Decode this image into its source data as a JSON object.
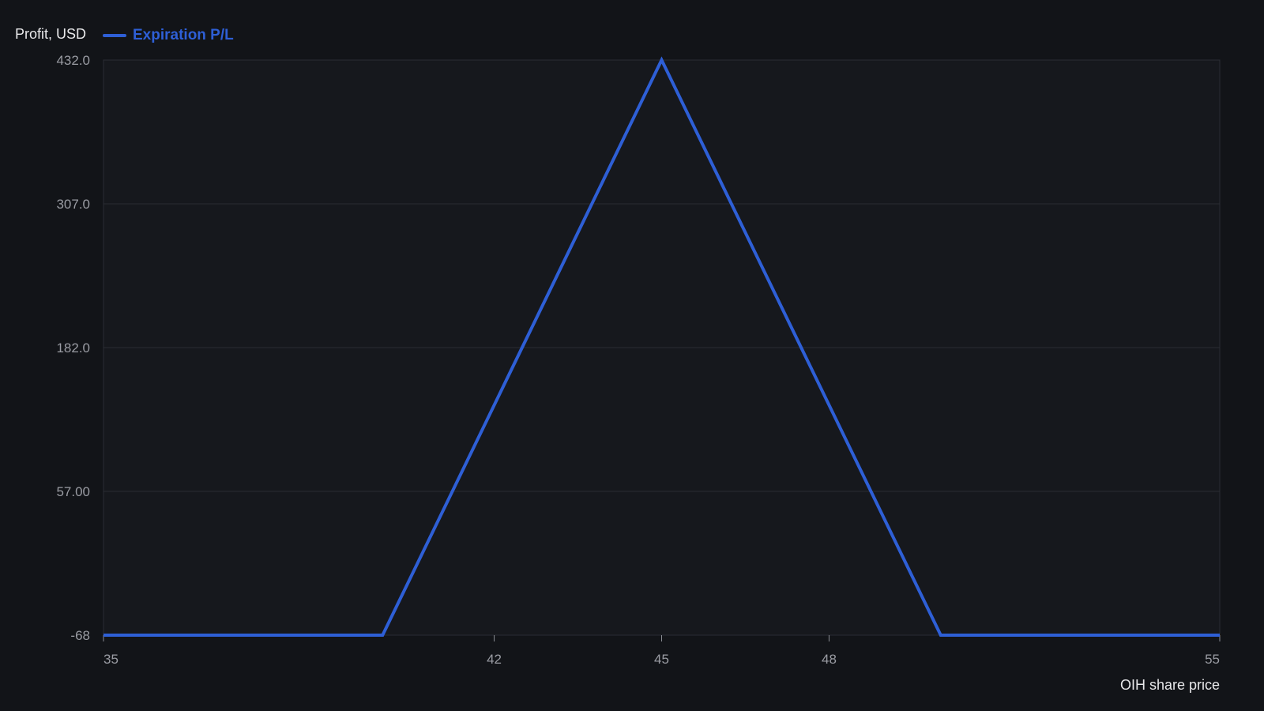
{
  "chart_data": {
    "type": "line",
    "ylabel": "Profit, USD",
    "xlabel": "OIH share price",
    "xlim": [
      35,
      55
    ],
    "ylim": [
      -68,
      432
    ],
    "x_ticks": [
      {
        "value": 35,
        "label": "35"
      },
      {
        "value": 42,
        "label": "42"
      },
      {
        "value": 45,
        "label": "45"
      },
      {
        "value": 48,
        "label": "48"
      },
      {
        "value": 55,
        "label": "55"
      }
    ],
    "y_ticks": [
      {
        "value": 432,
        "label": "432.0"
      },
      {
        "value": 307,
        "label": "307.0"
      },
      {
        "value": 182,
        "label": "182.0"
      },
      {
        "value": 57,
        "label": "57.00"
      },
      {
        "value": -68,
        "label": "-68"
      }
    ],
    "grid": true,
    "legend_position": "top-left",
    "series": [
      {
        "name": "Expiration P/L",
        "color": "#2e5fd6",
        "x": [
          35,
          40,
          45,
          50,
          55
        ],
        "y": [
          -68,
          -68,
          432,
          -68,
          -68
        ]
      }
    ]
  }
}
